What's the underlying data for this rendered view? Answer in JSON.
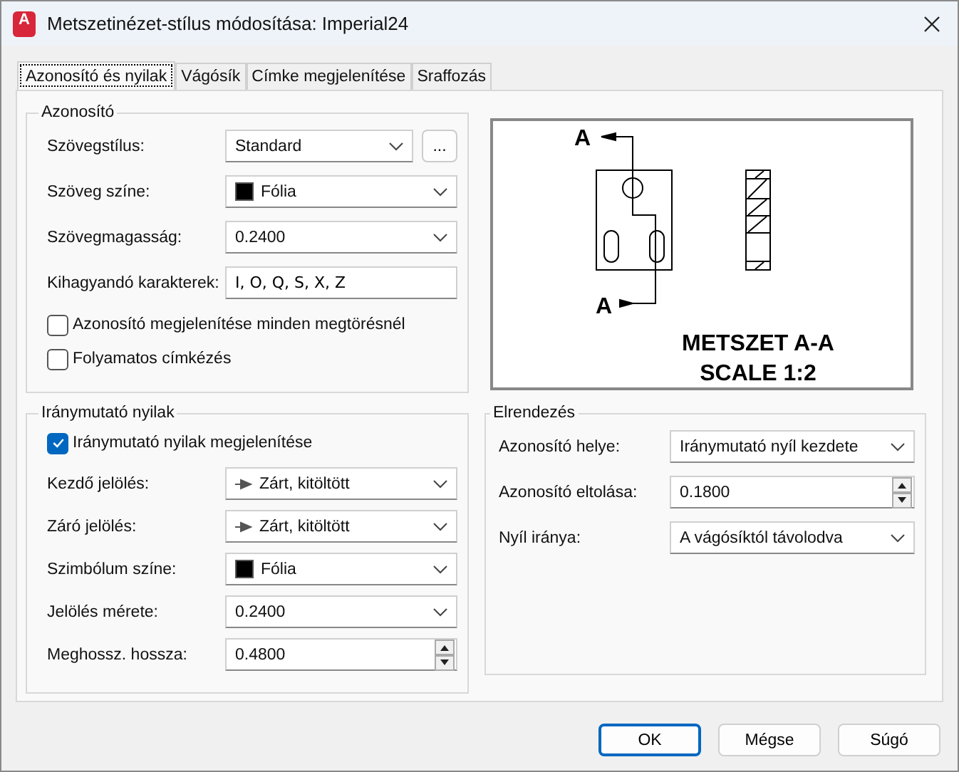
{
  "window": {
    "title": "Metszetinézet-stílus módosítása: Imperial24",
    "app_icon_letter": "A"
  },
  "tabs": [
    {
      "label": "Azonosító és nyilak",
      "selected": true
    },
    {
      "label": "Vágósík",
      "selected": false
    },
    {
      "label": "Címke megjelenítése",
      "selected": false
    },
    {
      "label": "Sraffozás",
      "selected": false
    }
  ],
  "identifier_group": {
    "title": "Azonosító",
    "fields": [
      {
        "kind": "select",
        "label": "Szövegstílus:",
        "value": "Standard",
        "button_label": "..."
      },
      {
        "kind": "color-select",
        "label": "Szöveg színe:",
        "value": "Fólia",
        "color": "#000000"
      },
      {
        "kind": "select",
        "label": "Szövegmagasság:",
        "value": "0.2400"
      },
      {
        "kind": "text",
        "label": "Kihagyandó karakterek:",
        "value": "I, O, Q, S, X, Z"
      }
    ],
    "checkboxes": [
      {
        "label": "Azonosító megjelenítése minden megtörésnél",
        "checked": false
      },
      {
        "label": "Folyamatos címkézés",
        "checked": false
      }
    ]
  },
  "arrows_group": {
    "title": "Iránymutató nyilak",
    "checkboxes": [
      {
        "label": "Iránymutató nyilak megjelenítése",
        "checked": true
      }
    ],
    "fields": [
      {
        "kind": "arrow-select",
        "label": "Kezdő jelölés:",
        "value": "Zárt, kitöltött"
      },
      {
        "kind": "arrow-select",
        "label": "Záró jelölés:",
        "value": "Zárt, kitöltött"
      },
      {
        "kind": "color-select",
        "label": "Szimbólum színe:",
        "value": "Fólia",
        "color": "#000000"
      },
      {
        "kind": "select",
        "label": "Jelölés mérete:",
        "value": "0.2400"
      },
      {
        "kind": "spin",
        "label": "Meghossz. hossza:",
        "value": "0.4800"
      }
    ]
  },
  "preview": {
    "cut_labels": [
      "A",
      "A"
    ],
    "caption": [
      "METSZET A-A",
      "SCALE 1:2"
    ]
  },
  "layout_group": {
    "title": "Elrendezés",
    "fields": [
      {
        "kind": "select",
        "label": "Azonosító helye:",
        "value": "Iránymutató nyíl kezdete"
      },
      {
        "kind": "spin",
        "label": "Azonosító eltolása:",
        "value": "0.1800"
      },
      {
        "kind": "select",
        "label": "Nyíl iránya:",
        "value": "A vágósíktól távolodva"
      }
    ]
  },
  "buttons": [
    "OK",
    "Mégse",
    "Súgó"
  ]
}
